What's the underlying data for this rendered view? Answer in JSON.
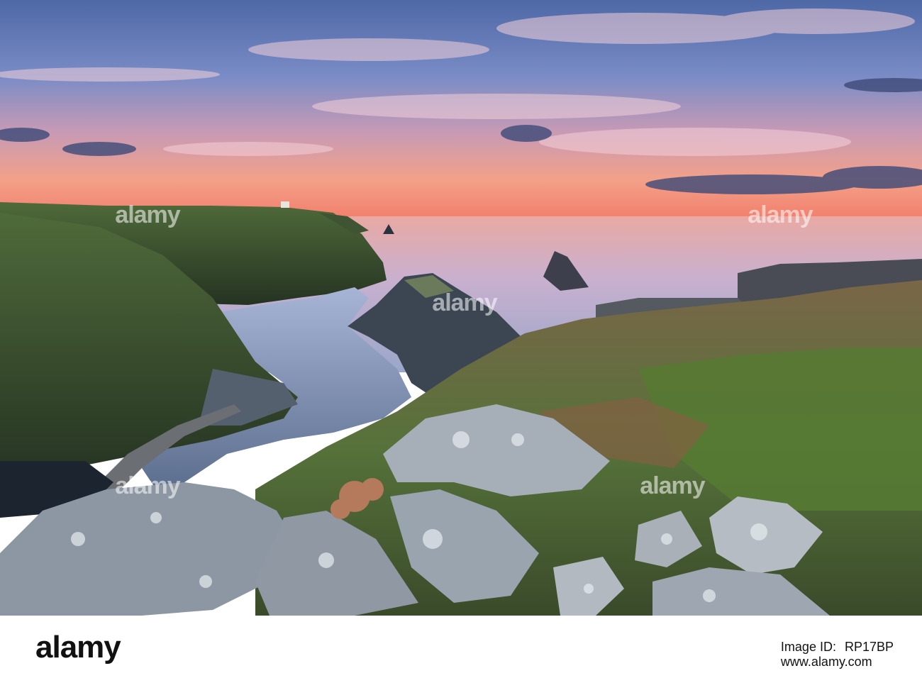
{
  "watermark": {
    "text": "alamy"
  },
  "footer": {
    "brand": "alamy",
    "image_id_label": "Image ID:",
    "image_id": "RP17BP",
    "url": "www.alamy.com"
  },
  "colors": {
    "sky_top": "#5b6fa8",
    "sunset": "#f08a7a",
    "sea": "#c9b3cf",
    "grass": "#5a7a3a",
    "rock": "#8e9aa8"
  }
}
